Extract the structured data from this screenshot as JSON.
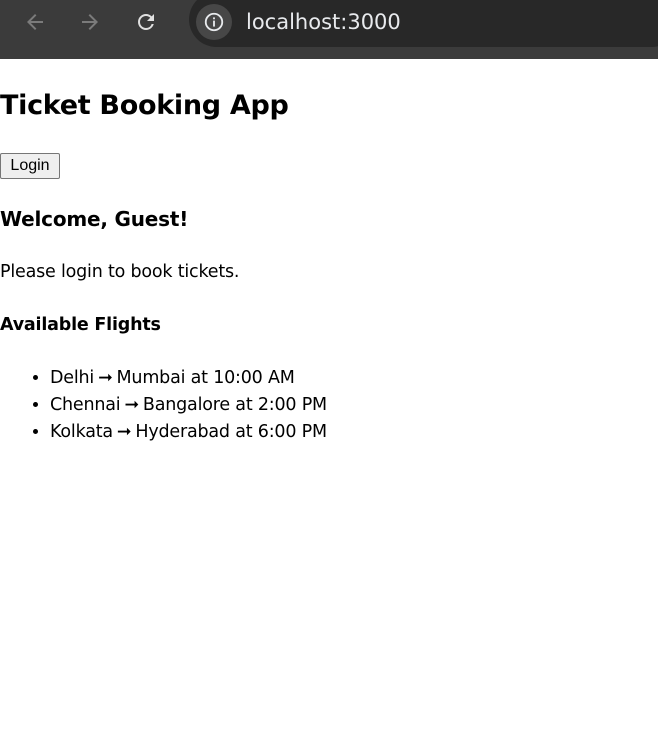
{
  "browser": {
    "url": "localhost:3000",
    "icons": {
      "back": "arrow-left-icon",
      "forward": "arrow-right-icon",
      "reload": "reload-icon",
      "site_info": "info-icon"
    },
    "colors": {
      "toolbar": "#3b3b3b",
      "omnibox": "#282828",
      "text": "#e8eaed"
    }
  },
  "app": {
    "title": "Ticket Booking App",
    "login_label": "Login",
    "welcome": "Welcome, Guest!",
    "login_message": "Please login to book tickets.",
    "flights_heading": "Available Flights",
    "flights": [
      {
        "from": "Delhi",
        "arrow": "➞",
        "to": "Mumbai",
        "time_text": "at 10:00 AM"
      },
      {
        "from": "Chennai",
        "arrow": "➞",
        "to": "Bangalore",
        "time_text": "at 2:00 PM"
      },
      {
        "from": "Kolkata",
        "arrow": "➞",
        "to": "Hyderabad",
        "time_text": "at 6:00 PM"
      }
    ]
  }
}
